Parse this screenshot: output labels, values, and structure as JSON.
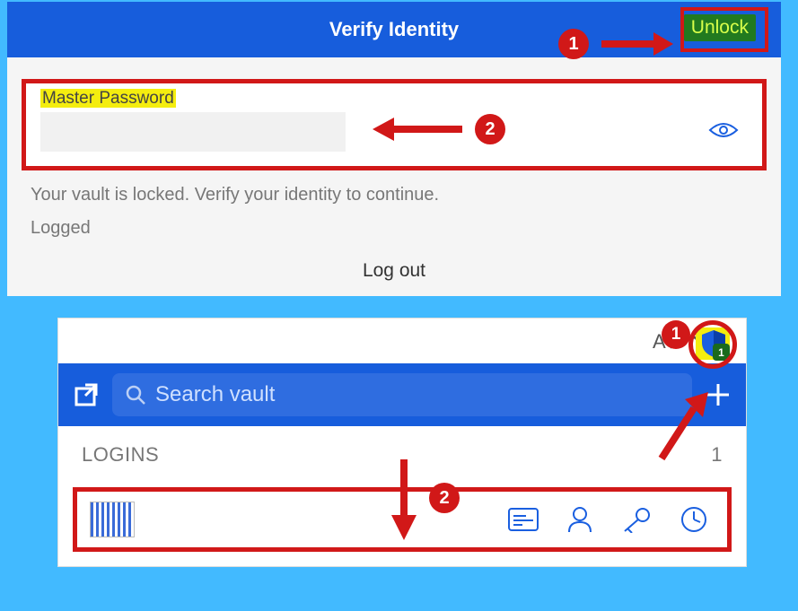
{
  "header": {
    "title": "Verify Identity",
    "unlock_label": "Unlock"
  },
  "password_field": {
    "label": "Master Password"
  },
  "status": {
    "locked_text": "Your vault is locked. Verify your identity to continue.",
    "logged_text": "Logged"
  },
  "logout_label": "Log out",
  "callouts": {
    "one": "1",
    "two": "2"
  },
  "popup": {
    "search_placeholder": "Search vault",
    "section_label": "LOGINS",
    "section_count": "1",
    "ext_badge": "1"
  }
}
